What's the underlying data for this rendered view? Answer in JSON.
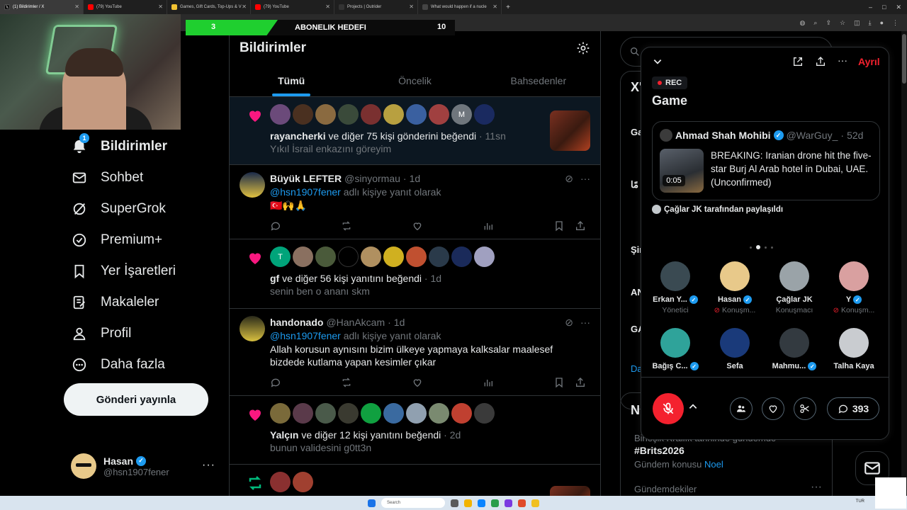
{
  "browser": {
    "tabs": [
      {
        "label": "(1) Bildirimler / X",
        "active": true
      },
      {
        "label": "(79) YouTube"
      },
      {
        "label": "Games, Gift Cards, Top-Ups & V"
      },
      {
        "label": "(79) YouTube"
      },
      {
        "label": "Projects | Outrider"
      },
      {
        "label": "What would happen if a nucle"
      }
    ],
    "new_tab": "+",
    "window_controls": [
      "–",
      "□",
      "✕"
    ]
  },
  "sub_goal": {
    "start": "3",
    "label": "ABONELIK HEDEFI",
    "end": "10",
    "progress": 0.3
  },
  "sidebar": {
    "items": [
      {
        "label": "Bildirimler",
        "icon": "bell-icon",
        "badge": "1",
        "active": true
      },
      {
        "label": "Sohbet",
        "icon": "mail-icon"
      },
      {
        "label": "SuperGrok",
        "icon": "grok-icon"
      },
      {
        "label": "Premium+",
        "icon": "premium-icon"
      },
      {
        "label": "Yer İşaretleri",
        "icon": "bookmark-icon"
      },
      {
        "label": "Makaleler",
        "icon": "article-icon"
      },
      {
        "label": "Profil",
        "icon": "person-icon"
      },
      {
        "label": "Daha fazla",
        "icon": "more-circle-icon"
      }
    ],
    "post_button": "Gönderi yayınla",
    "account": {
      "name": "Hasan",
      "handle": "@hsn1907fener",
      "more": "···"
    }
  },
  "main": {
    "title": "Bildirimler",
    "tabs": [
      "Tümü",
      "Öncelik",
      "Bahsedenler"
    ],
    "notifications": [
      {
        "type": "like",
        "avatar_letter": "M",
        "actor": "rayancherki",
        "text": " ve diğer 75 kişi gönderini beğendi",
        "time": "11sn",
        "sub": "Yıkıl İsrail enkazını göreyim"
      },
      {
        "type": "reply",
        "name": "Büyük LEFTER",
        "handle": "@sinyormau",
        "time": "1d",
        "reply_to": "@hsn1907fener",
        "reply_suffix": " adlı kişiye yanıt olarak",
        "body": "🇹🇷🙌🙏"
      },
      {
        "type": "like",
        "avatar_letter": "T",
        "actor": "gf",
        "text": " ve diğer 56 kişi yanıtını beğendi",
        "time": "1d",
        "sub": "senin ben o ananı skm"
      },
      {
        "type": "reply",
        "name": "handonado",
        "handle": "@HanAkcam",
        "time": "1d",
        "reply_to": "@hsn1907fener",
        "reply_suffix": " adlı kişiye yanıt olarak",
        "body": "Allah korusun aynısını bizim ülkeye yapmaya kalksalar maalesef bizdede kutlama yapan kesimler çıkar"
      },
      {
        "type": "like",
        "actor": "Yalçın",
        "text": " ve diğer 12 kişi yanıtını beğendi",
        "time": "2d",
        "sub": "bunun validesini g0tt3n"
      }
    ],
    "meta_sep": " · "
  },
  "right": {
    "search_placeholder": "A",
    "peek_letters": [
      "X'",
      "Ga",
      "مًا",
      "Şir",
      "AN",
      "GA",
      "Da"
    ],
    "trends_title": "N",
    "trend_context": "Birleşik Krallık tarihinde gündemde",
    "trend_tag": "#Brits2026",
    "trend_topic_prefix": "Gündem konusu ",
    "trend_topic_link": "Noel",
    "trend_more_title": "Gündemdekiler",
    "trend_more": "···"
  },
  "space": {
    "leave": "Ayrıl",
    "rec": "REC",
    "title": "Game",
    "tweet": {
      "name": "Ahmad Shah Mohibi",
      "handle": "@WarGuy_",
      "time": "52d",
      "duration": "0:05",
      "text": "BREAKING: Iranian drone hit the five-star Burj Al Arab hotel in Dubai, UAE. (Unconfirmed)"
    },
    "shared_by": "Çağlar JK tarafından paylaşıldı",
    "speakers": [
      {
        "name": "Erkan Y...",
        "role": "Yönetici",
        "verified": true,
        "muted": false,
        "color": "#3a4a52"
      },
      {
        "name": "Hasan",
        "role": "Konuşm...",
        "verified": true,
        "muted": true,
        "color": "#e8c98a"
      },
      {
        "name": "Çağlar JK",
        "role": "Konuşmacı",
        "verified": false,
        "muted": false,
        "color": "#9aa3a8"
      },
      {
        "name": "Y",
        "role": "Konuşm...",
        "verified": true,
        "muted": true,
        "color": "#d9a0a0"
      },
      {
        "name": "Bağış C...",
        "role": "",
        "verified": true,
        "muted": false,
        "color": "#2fa39a"
      },
      {
        "name": "Sefa",
        "role": "",
        "verified": false,
        "muted": false,
        "color": "#1a3a7a"
      },
      {
        "name": "Mahmu...",
        "role": "",
        "verified": true,
        "muted": false,
        "color": "#333a40"
      },
      {
        "name": "Talha Kaya",
        "role": "",
        "verified": false,
        "muted": false,
        "color": "#c9ccd0"
      }
    ],
    "listener_count": "393"
  },
  "taskbar": {
    "search": "Search",
    "tray": [
      "TUR"
    ]
  },
  "colors": {
    "accent": "#1d9bf0",
    "like": "#f91880",
    "retweet": "#00ba7c",
    "live": "#f4212e",
    "goal": "#1fcf2f"
  }
}
